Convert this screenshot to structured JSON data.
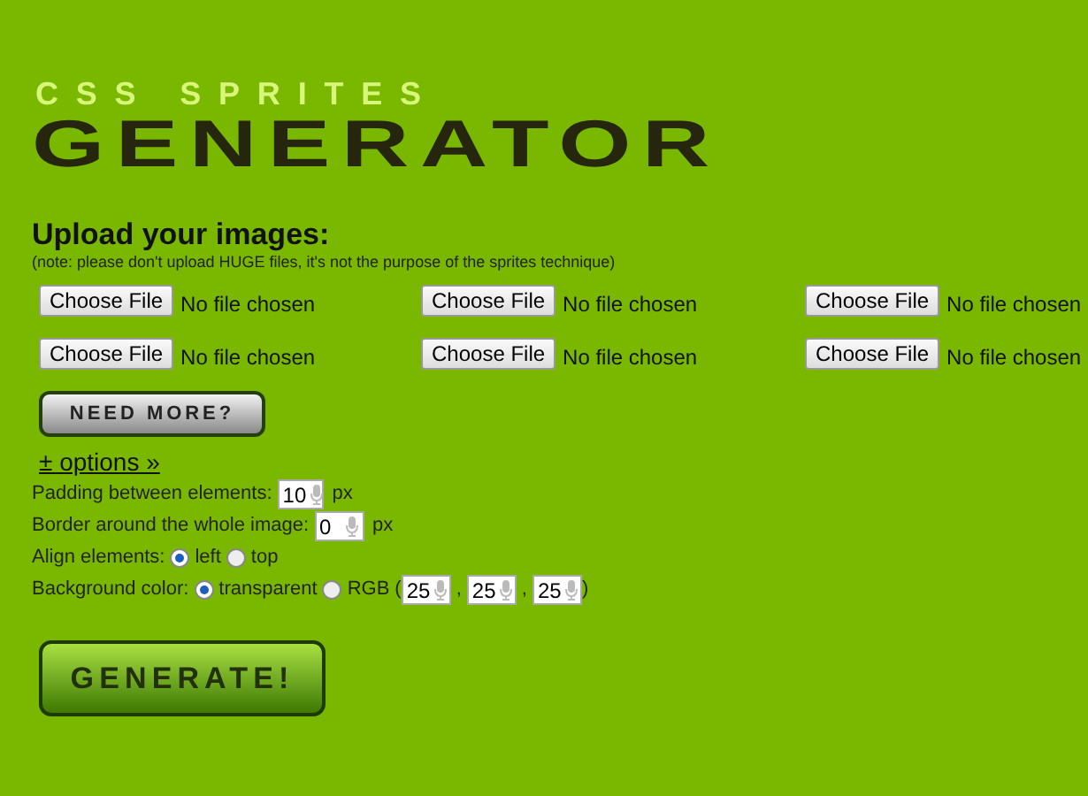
{
  "header": {
    "subtitle": "CSS SPRITES",
    "title": "GENERATOR"
  },
  "upload": {
    "heading": "Upload your images:",
    "note": "(note: please don't upload HUGE files, it's not the purpose of the sprites technique)",
    "files": [
      {
        "button": "Choose File",
        "status": "No file chosen"
      },
      {
        "button": "Choose File",
        "status": "No file chosen"
      },
      {
        "button": "Choose File",
        "status": "No file chosen"
      },
      {
        "button": "Choose File",
        "status": "No file chosen"
      },
      {
        "button": "Choose File",
        "status": "No file chosen"
      },
      {
        "button": "Choose File",
        "status": "No file chosen"
      }
    ],
    "more_button": "NEED MORE?"
  },
  "options": {
    "link": "± options »",
    "rows": [
      {
        "kind": "number",
        "label": "Padding between elements:",
        "fields": [
          {
            "value": "10"
          }
        ],
        "unit": "px"
      },
      {
        "kind": "number",
        "label": "Border around the whole image:",
        "fields": [
          {
            "value": "0"
          }
        ],
        "unit": "px"
      },
      {
        "kind": "radio",
        "label": "Align elements:",
        "choices": [
          {
            "label": "left",
            "selected": true
          },
          {
            "label": "top",
            "selected": false
          }
        ]
      },
      {
        "kind": "radio",
        "label": "Background color:",
        "choices": [
          {
            "label": "transparent",
            "selected": true
          },
          {
            "label": "RGB",
            "selected": false
          }
        ],
        "open": "(",
        "fields": [
          {
            "value": "25"
          },
          {
            "value": "25"
          },
          {
            "value": "25"
          }
        ],
        "separator": ",",
        "close": ")"
      }
    ]
  },
  "generate_button": "GENERATE!"
}
